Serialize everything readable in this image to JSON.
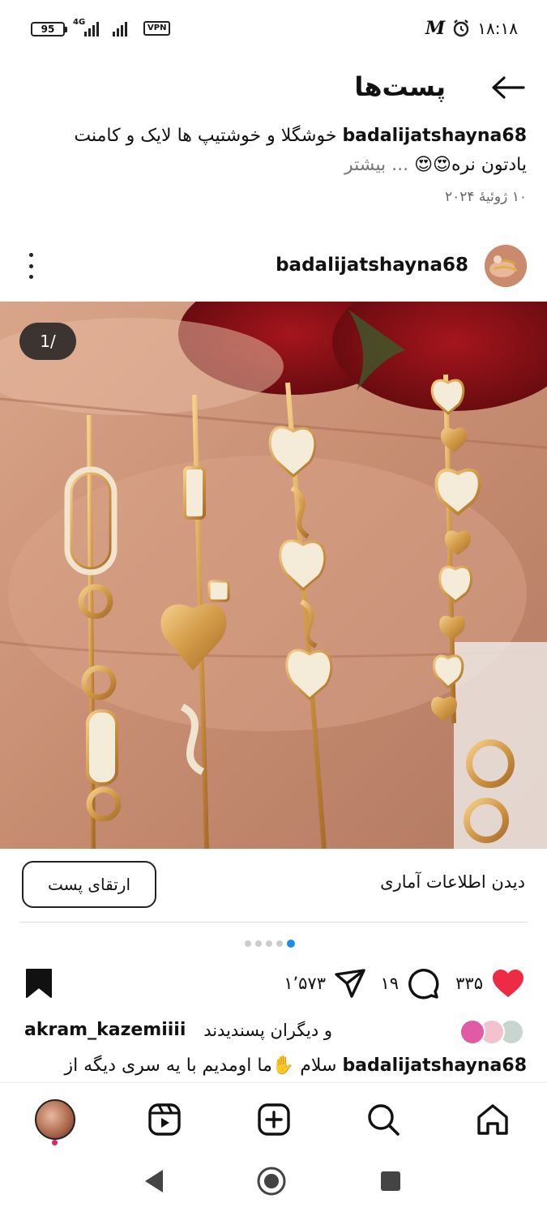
{
  "status_bar": {
    "battery": "95",
    "network": "4G",
    "vpn": "VPN",
    "time": "۱۸:۱۸",
    "icons": [
      "battery-icon",
      "signal-icon",
      "vpn-icon",
      "m-logo-icon",
      "alarm-icon"
    ]
  },
  "header": {
    "title": "پست‌ها",
    "back_icon": "arrow-left-icon"
  },
  "top_caption": {
    "username": "badalijatshayna68",
    "text": "خوشگلا و خوشتیپ ها لایک و کامنت یادتون نره😍😍",
    "more": "... بیشتر",
    "date": "۱۰ ژوئیهٔ ۲۰۲۴"
  },
  "post": {
    "username": "badalijatshayna68",
    "image_counter": "1/",
    "more_icon": "more-vertical-icon"
  },
  "actions": {
    "insights": "دیدن اطلاعات آماری",
    "boost": "ارتقای پست"
  },
  "carousel": {
    "dots": 5,
    "active": 4
  },
  "engagement": {
    "likes": "۳۳۵",
    "comments": "۱۹",
    "shares": "۱٬۵۷۳",
    "like_color": "#ed2b45"
  },
  "liked_by": {
    "username": "akram_kazemiiii",
    "text": "و دیگران پسندیدند"
  },
  "bottom_caption": {
    "username": "badalijatshayna68",
    "text": "سلام ✋ما اومدیم با یه سری دیگه از"
  },
  "bottom_nav": {
    "items": [
      "home-icon",
      "search-icon",
      "create-icon",
      "reels-icon",
      "profile-avatar"
    ]
  },
  "colors": {
    "accent_blue": "#1a8cf0",
    "like_red": "#ed2b45",
    "notification_dot": "#e0245e"
  }
}
